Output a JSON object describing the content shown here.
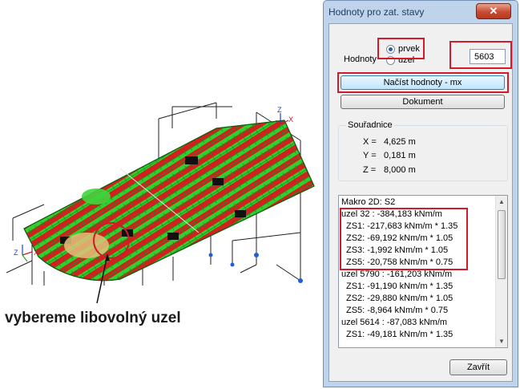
{
  "caption": "vybereme libovolný uzel",
  "model": {
    "axis_labels": [
      "Z",
      "X",
      "Z",
      "X"
    ]
  },
  "dialog": {
    "title": "Hodnoty pro zat. stavy",
    "close_glyph": "✕",
    "hodnoty_label": "Hodnoty",
    "radio_prvek": "prvek",
    "radio_uzel": "uzel",
    "selected_radio": "prvek",
    "element_number": "5603",
    "load_button": "Načíst hodnoty - mx",
    "document_button": "Dokument",
    "souradnice": {
      "title": "Souřadnice",
      "x_label": "X =",
      "x_value": "4,625 m",
      "y_label": "Y =",
      "y_value": "0,181 m",
      "z_label": "Z =",
      "z_value": "8,000 m"
    },
    "list_items": [
      "Makro 2D: S2",
      "uzel 32 : -384,183 kNm/m",
      "  ZS1: -217,683 kNm/m * 1.35",
      "  ZS2: -69,192 kNm/m * 1.05",
      "  ZS3: -1,992 kNm/m * 1.05",
      "  ZS5: -20,758 kNm/m * 0.75",
      "uzel 5790 : -161,203 kNm/m",
      "  ZS1: -91,190 kNm/m * 1.35",
      "  ZS2: -29,880 kNm/m * 1.05",
      "  ZS5: -8,964 kNm/m * 0.75",
      "uzel 5614 : -87,083 kNm/m",
      "  ZS1: -49,181 kNm/m * 1.35"
    ],
    "close_button": "Zavřít"
  },
  "colors": {
    "highlight_red": "#d21a2a",
    "slab_red": "#d41f1f",
    "slab_green": "#2fd12f",
    "dialog_frame": "#bfd3ea"
  }
}
